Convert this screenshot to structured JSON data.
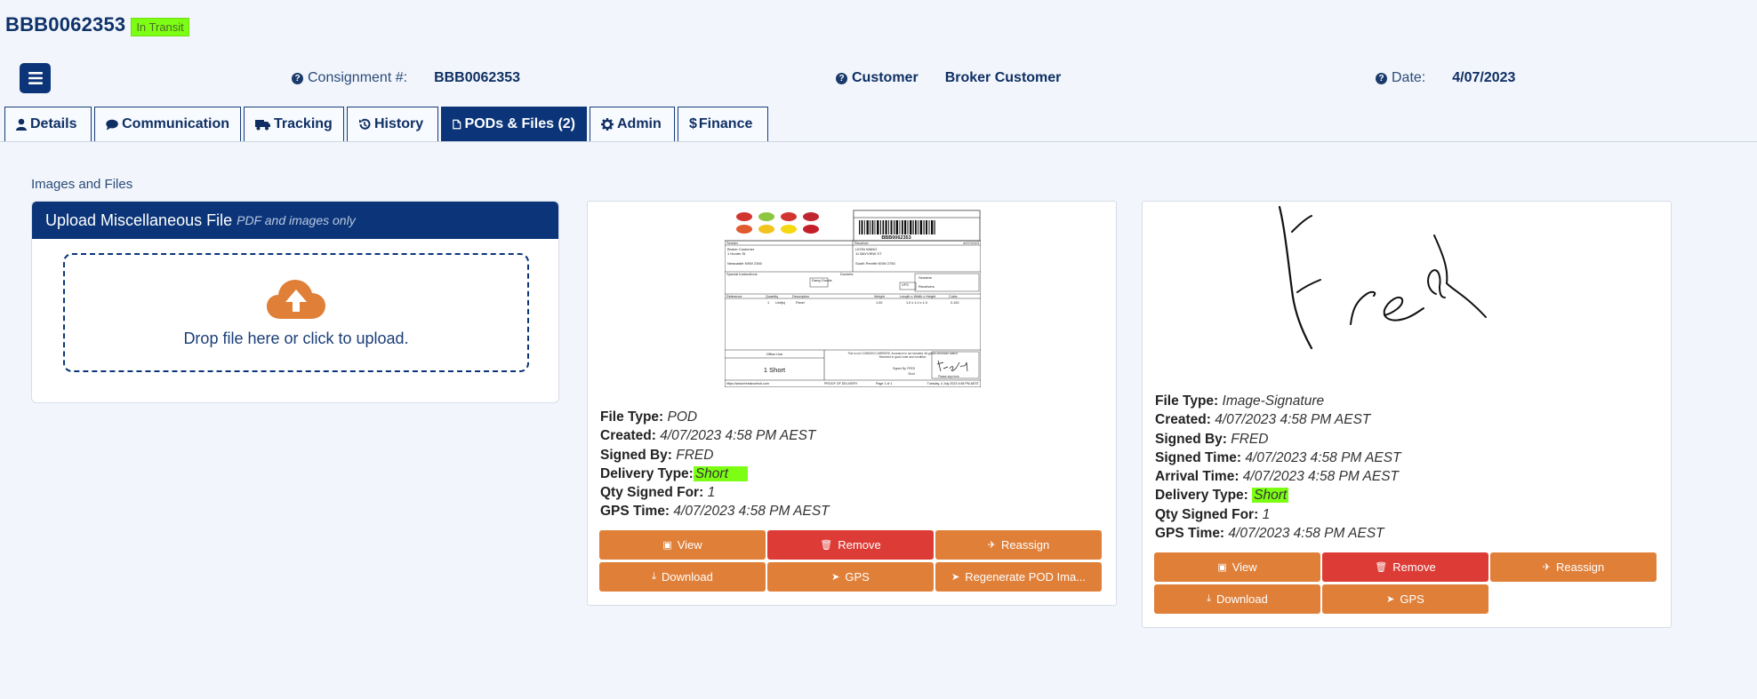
{
  "header": {
    "title": "BBB0062353",
    "status": "In Transit",
    "consignment_label": "Consignment #:",
    "consignment_value": "BBB0062353",
    "customer_label": "Customer",
    "customer_value": "Broker Customer",
    "date_label": "Date:",
    "date_value": "4/07/2023"
  },
  "tabs": [
    {
      "label": "Details",
      "icon": "user-icon"
    },
    {
      "label": "Communication",
      "icon": "comment-icon"
    },
    {
      "label": "Tracking",
      "icon": "truck-icon"
    },
    {
      "label": "History",
      "icon": "history-icon"
    },
    {
      "label": "PODs & Files (2)",
      "icon": "file-icon",
      "active": true
    },
    {
      "label": "Admin",
      "icon": "gear-icon"
    },
    {
      "label": "Finance",
      "icon": "dollar-icon"
    }
  ],
  "section_label": "Images and Files",
  "upload": {
    "title": "Upload Miscellaneous File",
    "subtitle": "PDF and images only",
    "drop_text": "Drop file here or click to upload."
  },
  "files": [
    {
      "file_type": "POD",
      "created": "4/07/2023 4:58 PM AEST",
      "signed_by": "FRED",
      "delivery_type": "Short",
      "qty_signed_for": "1",
      "gps_time": "4/07/2023 4:58 PM AEST",
      "buttons": [
        "View",
        "Remove",
        "Reassign",
        "Download",
        "GPS",
        "Regenerate POD Ima..."
      ],
      "thumb": {
        "barcode": "BBB0062353",
        "sender_label": "Sender",
        "receiver_label": "Receiver",
        "date": "4/07/2023",
        "sender_name": "Broker Customer",
        "sender_street": "1 Hunter St",
        "sender_city": "Newcastle NSW 2300",
        "receiver_name": "LEON WANG",
        "receiver_street": "11 BAYVIEW ST",
        "receiver_city": "South Penrith NSW 2750",
        "special_instructions": "Special Instructions",
        "dockets": "Dockets",
        "dang_goods": "Dang Goods",
        "vfs": "VFS",
        "senders": "Senders",
        "receivers": "Receivers",
        "col_reference": "Reference",
        "col_quantity": "Quantity",
        "col_description": "Description",
        "col_weight": "Weight",
        "col_dims": "Length x Width x Height",
        "col_cubic": "Cubic",
        "row_qty": "1",
        "row_unit": "Unit(s)",
        "row_desc": "Panel",
        "row_weight": "1.00",
        "row_dims": "1.0 x 1.0 x 1.0",
        "row_cubic": "0.100",
        "office_use": "Office Use",
        "short_note": "1 Short",
        "terms_1": "This is not COMMON CARRIERS. Insurance is not included. All goods otherwise stated",
        "terms_2": "Received in good order and condition",
        "signed_by": "Signed By: FRED",
        "short": "Short",
        "please_sign": "Please sign here",
        "footer_site": "https://www.freelancehub.com",
        "footer_title": "PROOF OF DELIVERY",
        "footer_page": "Page 1 of 1",
        "footer_date": "Tuesday, 4 July 2023 4:58 PM AEST"
      }
    },
    {
      "file_type": "Image-Signature",
      "created": "4/07/2023 4:58 PM AEST",
      "signed_by": "FRED",
      "signed_time": "4/07/2023 4:58 PM AEST",
      "arrival_time": "4/07/2023 4:58 PM AEST",
      "delivery_type": "Short",
      "qty_signed_for": "1",
      "gps_time": "4/07/2023 4:58 PM AEST",
      "buttons": [
        "View",
        "Remove",
        "Reassign",
        "Download",
        "GPS"
      ]
    }
  ],
  "meta_labels": {
    "file_type": "File Type:",
    "created": "Created:",
    "signed_by": "Signed By:",
    "signed_time": "Signed Time:",
    "arrival_time": "Arrival Time:",
    "delivery_type": "Delivery Type:",
    "qty_signed_for": "Qty Signed For:",
    "gps_time": "GPS Time:"
  },
  "colors": {
    "primary": "#0b3578",
    "accent_orange": "#e07f38",
    "danger_red": "#dd3b36",
    "highlight_green": "#7dff14"
  }
}
